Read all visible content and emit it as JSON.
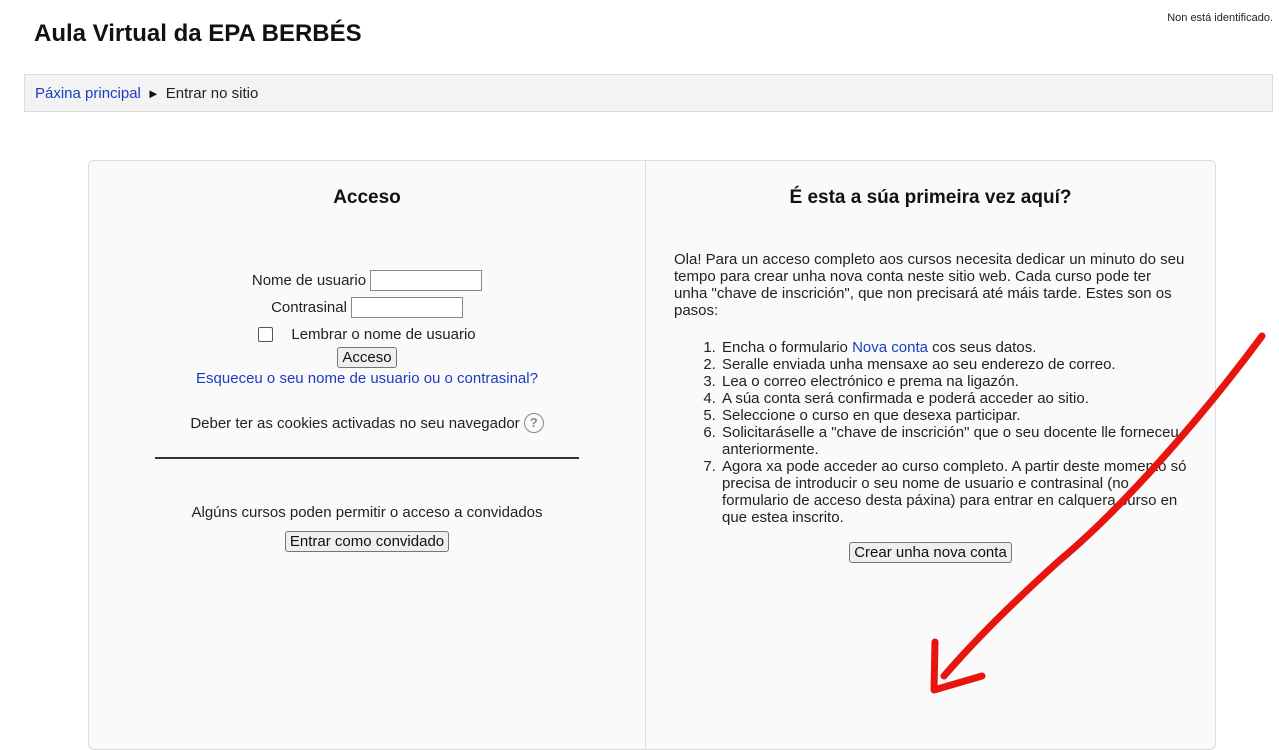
{
  "header": {
    "login_info": "Non está identificado.",
    "site_title": "Aula Virtual da EPA BERBÉS"
  },
  "breadcrumb": {
    "home": "Páxina principal",
    "separator": "►",
    "current": "Entrar no sitio"
  },
  "login": {
    "heading": "Acceso",
    "username_label": "Nome de usuario",
    "username_value": "",
    "password_label": "Contrasinal",
    "password_value": "",
    "remember_label": "Lembrar o nome de usuario",
    "remember_checked": false,
    "submit_label": "Acceso",
    "forgot_link": "Esqueceu o seu nome de usuario ou o contrasinal?",
    "cookies_note": "Deber ter as cookies activadas no seu navegador",
    "guest_note": "Algúns cursos poden permitir o acceso a convidados",
    "guest_button": "Entrar como convidado"
  },
  "signup": {
    "heading": "É esta a súa primeira vez aquí?",
    "intro": "Ola! Para un acceso completo aos cursos necesita dedicar un minuto do seu tempo para crear unha nova conta neste sitio web. Cada curso pode ter unha \"chave de inscrición\", que non precisará até máis tarde. Estes son os pasos:",
    "step1_before": "Encha o formulario ",
    "step1_link": "Nova conta",
    "step1_after": " cos seus datos.",
    "steps": [
      "Seralle enviada unha mensaxe ao seu enderezo de correo.",
      "Lea o correo electrónico e prema na ligazón.",
      "A súa conta será confirmada e poderá acceder ao sitio.",
      "Seleccione o curso en que desexa participar.",
      "Solicitaráselle a \"chave de inscrición\" que o seu docente lle forneceu anteriormente.",
      "Agora xa pode acceder ao curso completo. A partir deste momento só precisa de introducir o seu nome de usuario e contrasinal (no formulario de acceso desta páxina) para entrar en calquera curso en que estea inscrito."
    ],
    "create_button": "Crear unha nova conta"
  },
  "colors": {
    "link": "#1a3dbf",
    "annotation_arrow": "#e8150f"
  },
  "icons": {
    "help": "question-circle-icon",
    "breadcrumb_separator": "triangle-right-icon"
  }
}
